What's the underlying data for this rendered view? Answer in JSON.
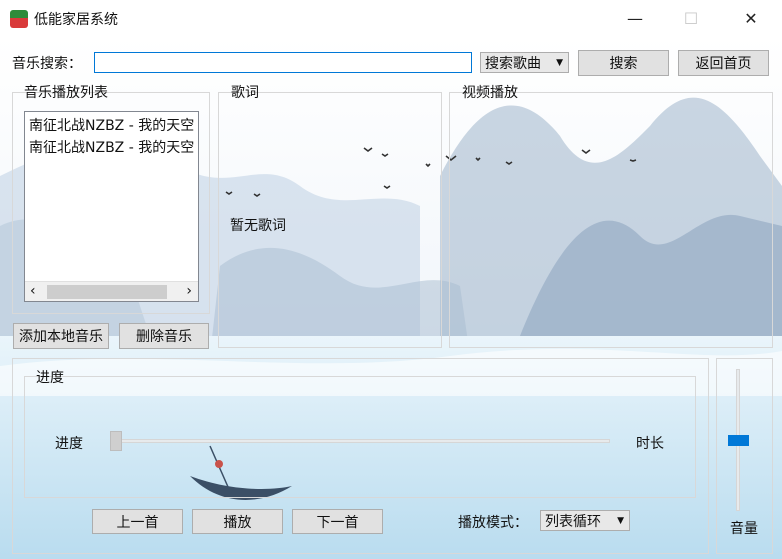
{
  "window": {
    "title": "低能家居系统",
    "minimize_glyph": "—",
    "maximize_glyph": "☐",
    "close_glyph": "✕"
  },
  "search": {
    "label": "音乐搜索：",
    "value": "",
    "mode_selected": "搜索歌曲",
    "search_button": "搜索",
    "home_button": "返回首页"
  },
  "playlist": {
    "title": "音乐播放列表",
    "items": [
      "南征北战NZBZ - 我的天空",
      "南征北战NZBZ - 我的天空"
    ],
    "add_button": "添加本地音乐",
    "delete_button": "删除音乐"
  },
  "lyrics": {
    "title": "歌词",
    "placeholder": "暂无歌词"
  },
  "video": {
    "title": "视频播放"
  },
  "progress": {
    "group_title": "进度",
    "label": "进度",
    "duration_label": "时长",
    "value_fraction": 0.0
  },
  "controls": {
    "prev": "上一首",
    "play": "播放",
    "next": "下一首",
    "mode_label": "播放模式：",
    "mode_selected": "列表循环"
  },
  "volume": {
    "label": "音量",
    "level_fraction": 0.5
  },
  "icons": {
    "left": "‹",
    "right": "›",
    "dropdown": "▼"
  }
}
